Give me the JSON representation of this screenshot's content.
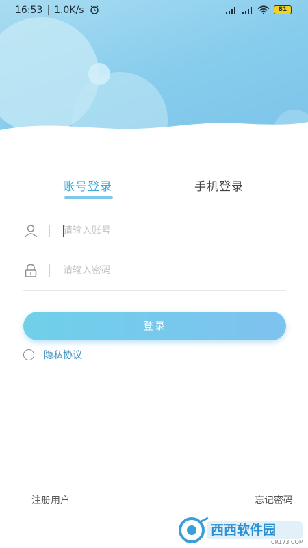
{
  "status_bar": {
    "time": "16:53",
    "net_speed": "1.0K/s",
    "battery": "81"
  },
  "tabs": [
    {
      "label": "账号登录",
      "active": true
    },
    {
      "label": "手机登录",
      "active": false
    }
  ],
  "form": {
    "account_placeholder": "请输入账号",
    "password_placeholder": "请输入密码",
    "login_label": "登录"
  },
  "privacy": {
    "label": "隐私协议",
    "checked": false
  },
  "footer": {
    "register_label": "注册用户",
    "forgot_label": "忘记密码"
  },
  "watermark": {
    "brand_text": "西西软件园",
    "domain_text": "CR173.COM"
  },
  "colors": {
    "accent": "#3fa8d9",
    "header_blue": "#86ccec",
    "button_start": "#6fd0ea",
    "button_end": "#7ec2ef"
  }
}
